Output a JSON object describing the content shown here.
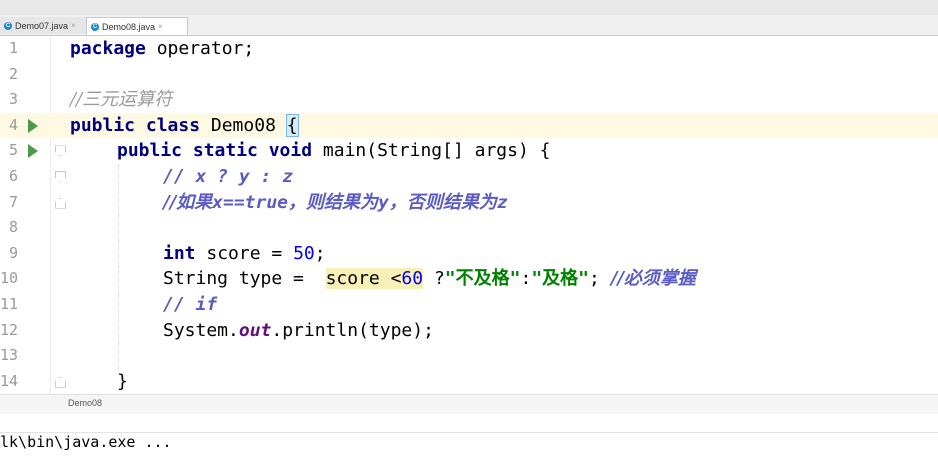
{
  "tabs": [
    {
      "name": "Demo07.java",
      "active": false
    },
    {
      "name": "Demo08.java",
      "active": true
    }
  ],
  "lines": [
    {
      "num": "1"
    },
    {
      "num": "2"
    },
    {
      "num": "3"
    },
    {
      "num": "4"
    },
    {
      "num": "5"
    },
    {
      "num": "6"
    },
    {
      "num": "7"
    },
    {
      "num": "8"
    },
    {
      "num": "9"
    },
    {
      "num": "10"
    },
    {
      "num": "11"
    },
    {
      "num": "12"
    },
    {
      "num": "13"
    },
    {
      "num": "14"
    }
  ],
  "code": {
    "l1_kw": "package",
    "l1_rest": " operator;",
    "l3_cm": "//三元运算符",
    "l4_kw": "public class",
    "l4_name": " Demo08 ",
    "l4_brace": "{",
    "l5_kw": "public static void",
    "l5_rest": " main(String[] args) {",
    "l6_cm": "// x ? y : z",
    "l7_cm1": "//如果",
    "l7_cm2": "x==true",
    "l7_cm3": "，则结果为",
    "l7_cm4": "y",
    "l7_cm5": "，否则结果为",
    "l7_cm6": "z",
    "l9_kw": "int",
    "l9_rest": " score = ",
    "l9_num": "50",
    "l9_end": ";",
    "l10_a": "String type =  ",
    "l10_b": "score <",
    "l10_num": "60",
    "l10_c": " ?",
    "l10_s1": "\"不及格\"",
    "l10_d": ":",
    "l10_s2": "\"及格\"",
    "l10_e": "; ",
    "l10_cm": "//必须掌握",
    "l11_cm1": "// ",
    "l11_cm2": "if",
    "l12_a": "System.",
    "l12_out": "out",
    "l12_b": ".println(type);",
    "l14": "}"
  },
  "breadcrumb": "Demo08",
  "console_text": "lk\\bin\\java.exe ...",
  "colors": {
    "keyword": "#000080",
    "number": "#0000ff",
    "string": "#008000",
    "comment": "#808080",
    "field": "#660e7a",
    "run_icon": "#4c9a4c"
  }
}
